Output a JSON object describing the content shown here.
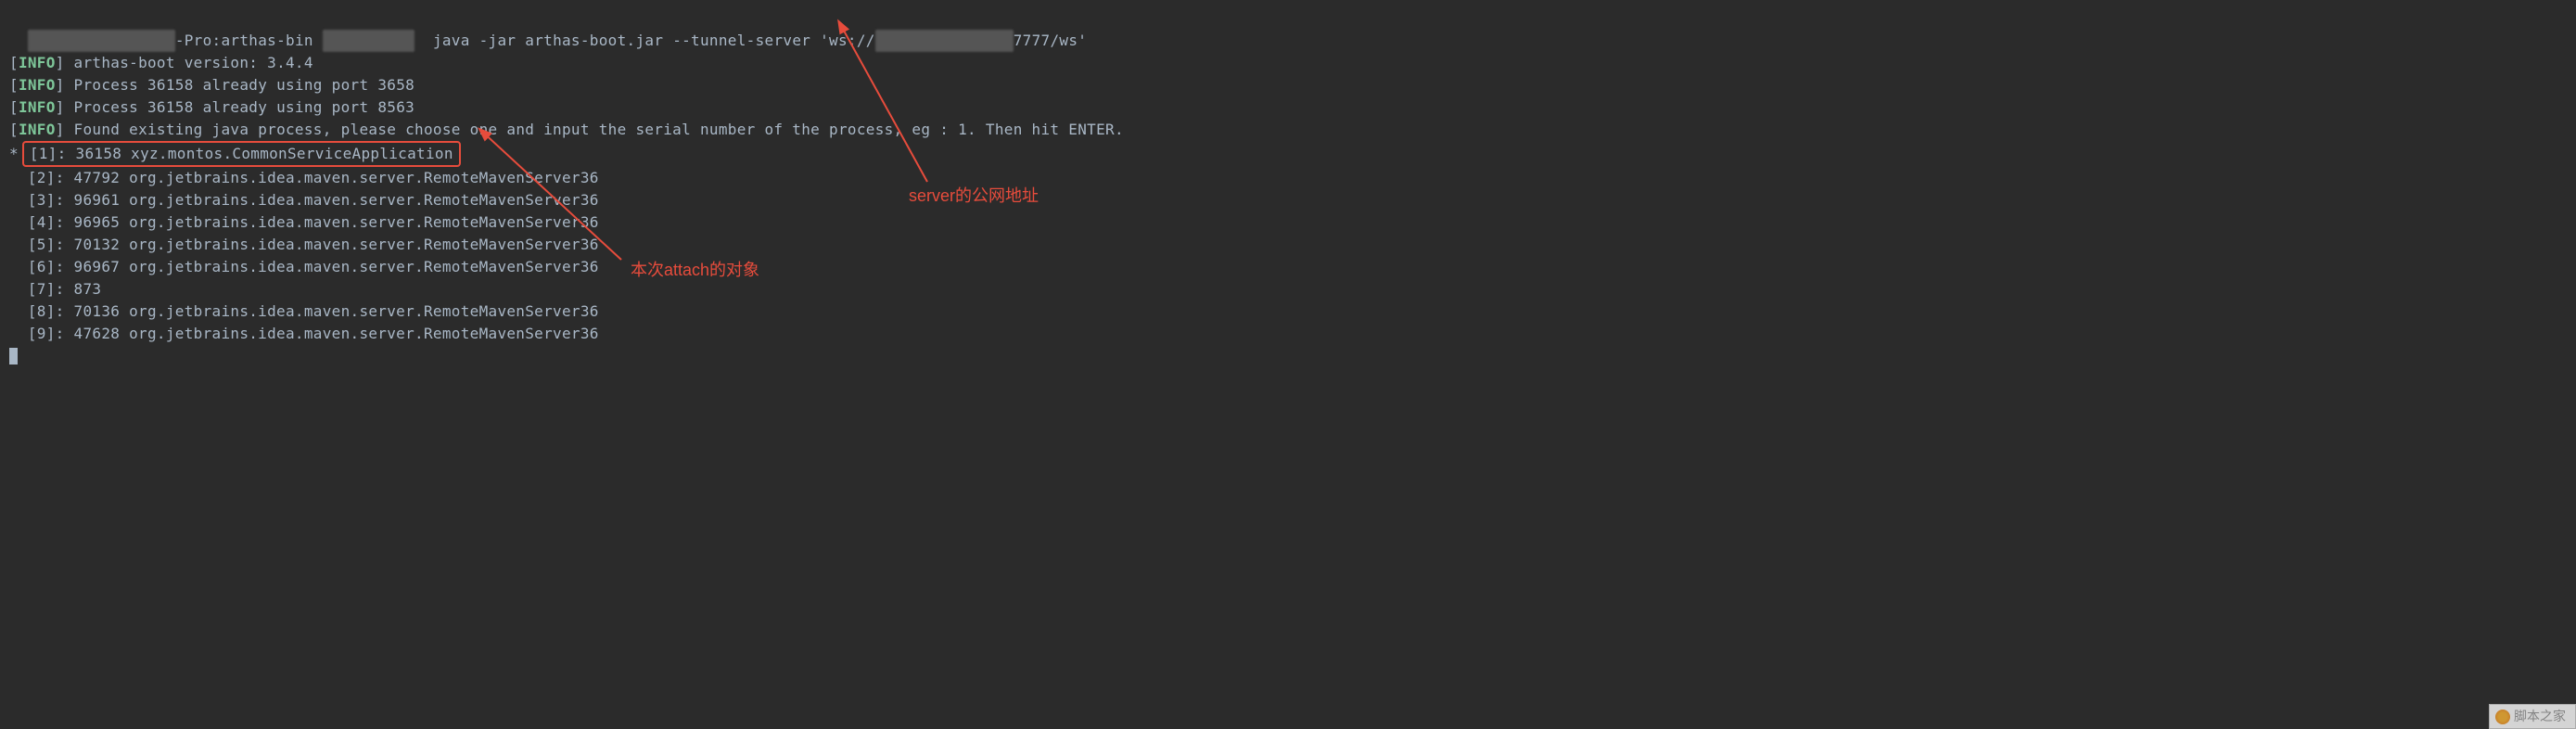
{
  "prompt": {
    "host_prefix_hidden": "████████████ ███",
    "host_suffix": "-Pro:arthas-bin ",
    "user_hidden": "██████████",
    "command_prefix": "  java -jar arthas-boot.jar --tunnel-server 'ws://",
    "ip_hidden": "███ ███ ███ ███",
    "command_suffix": "7777/ws'"
  },
  "lines": [
    {
      "type": "info",
      "text": "arthas-boot version: 3.4.4"
    },
    {
      "type": "info",
      "text": "Process 36158 already using port 3658"
    },
    {
      "type": "info",
      "text": "Process 36158 already using port 8563"
    },
    {
      "type": "info",
      "text": "Found existing java process, please choose one and input the serial number of the process, eg : 1. Then hit ENTER."
    }
  ],
  "processes": [
    {
      "idx": "[1]",
      "pid": "36158",
      "name": "xyz.montos.CommonServiceApplication",
      "selected": true
    },
    {
      "idx": "[2]",
      "pid": "47792",
      "name": "org.jetbrains.idea.maven.server.RemoteMavenServer36",
      "selected": false
    },
    {
      "idx": "[3]",
      "pid": "96961",
      "name": "org.jetbrains.idea.maven.server.RemoteMavenServer36",
      "selected": false
    },
    {
      "idx": "[4]",
      "pid": "96965",
      "name": "org.jetbrains.idea.maven.server.RemoteMavenServer36",
      "selected": false
    },
    {
      "idx": "[5]",
      "pid": "70132",
      "name": "org.jetbrains.idea.maven.server.RemoteMavenServer36",
      "selected": false
    },
    {
      "idx": "[6]",
      "pid": "96967",
      "name": "org.jetbrains.idea.maven.server.RemoteMavenServer36",
      "selected": false
    },
    {
      "idx": "[7]",
      "pid": "873",
      "name": "",
      "selected": false
    },
    {
      "idx": "[8]",
      "pid": "70136",
      "name": "org.jetbrains.idea.maven.server.RemoteMavenServer36",
      "selected": false
    },
    {
      "idx": "[9]",
      "pid": "47628",
      "name": "org.jetbrains.idea.maven.server.RemoteMavenServer36",
      "selected": false
    }
  ],
  "annotations": {
    "attach_target": "本次attach的对象",
    "server_address": "server的公网地址"
  },
  "watermark": "脚本之家"
}
